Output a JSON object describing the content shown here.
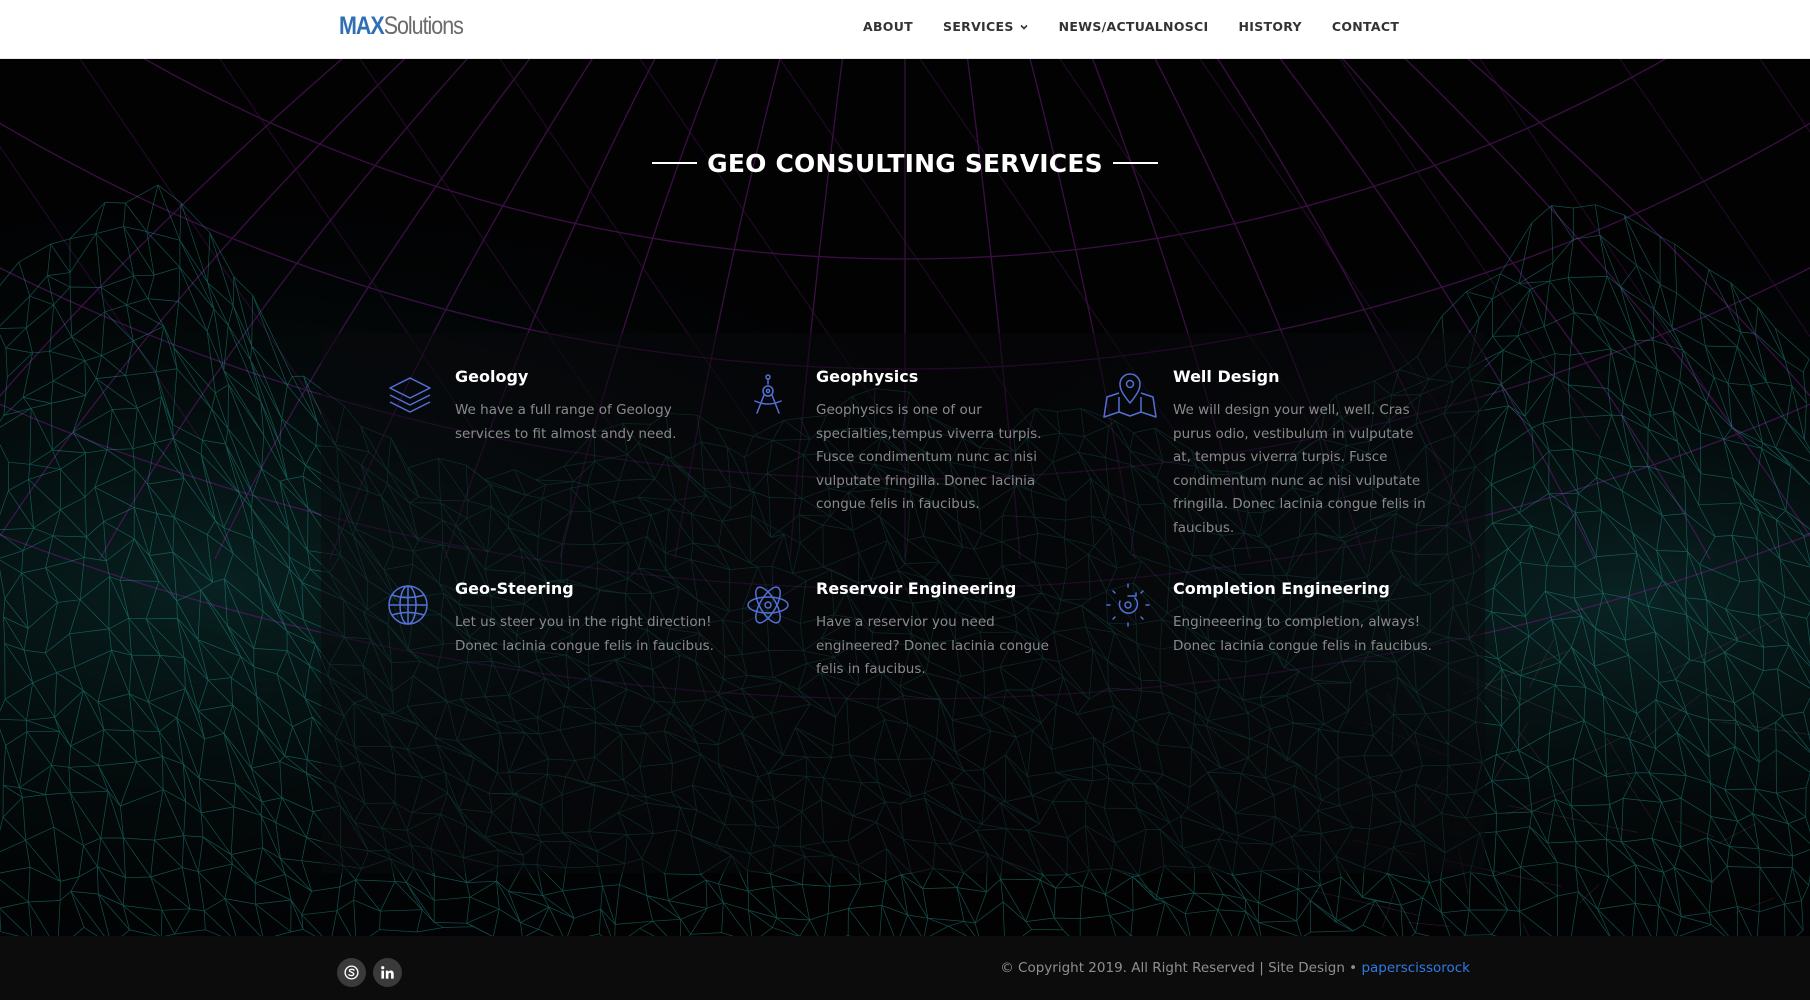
{
  "header": {
    "logo_primary": "MAX",
    "logo_secondary": "Solutions",
    "nav": [
      {
        "label": "ABOUT"
      },
      {
        "label": "SERVICES",
        "has_dropdown": true
      },
      {
        "label": "NEWS/ACTUALNOSCI"
      },
      {
        "label": "HISTORY"
      },
      {
        "label": "CONTACT"
      }
    ]
  },
  "section": {
    "title": "GEO CONSULTING SERVICES"
  },
  "services": [
    {
      "icon": "layers-icon",
      "title": "Geology",
      "description": "We have a full range of Geology services to fit almost andy need."
    },
    {
      "icon": "compass-icon",
      "title": "Geophysics",
      "description": "Geophysics is one of our specialties,tempus viverra turpis. Fusce condimentum nunc ac nisi vulputate fringilla. Donec lacinia congue felis in faucibus."
    },
    {
      "icon": "map-pin-icon",
      "title": "Well Design",
      "description": "We will design your well, well. Cras purus odio, vestibulum in vulputate at, tempus viverra turpis. Fusce condimentum nunc ac nisi vulputate fringilla. Donec lacinia congue felis in faucibus."
    },
    {
      "icon": "globe-icon",
      "title": "Geo-Steering",
      "description": "Let us steer you in the right direction! Donec lacinia congue felis in faucibus."
    },
    {
      "icon": "atom-icon",
      "title": "Reservoir Engineering",
      "description": "Have a reservior you need engineered? Donec lacinia congue felis in faucibus."
    },
    {
      "icon": "target-icon",
      "title": "Completion Engineering",
      "description": "Engineeering to completion, always! Donec lacinia congue felis in faucibus."
    }
  ],
  "footer": {
    "social": [
      {
        "icon": "skype-icon"
      },
      {
        "icon": "linkedin-icon"
      }
    ],
    "copyright_text": "© Copyright 2019. All Right Reserved | Site Design • ",
    "credit_link": "paperscissorock"
  },
  "colors": {
    "accent_blue": "#2f6fb3",
    "icon_blue": "#5470d6",
    "mesh_teal": "#27c6bd",
    "grid_purple": "#7a1d86",
    "link_blue": "#2f7ae5"
  }
}
